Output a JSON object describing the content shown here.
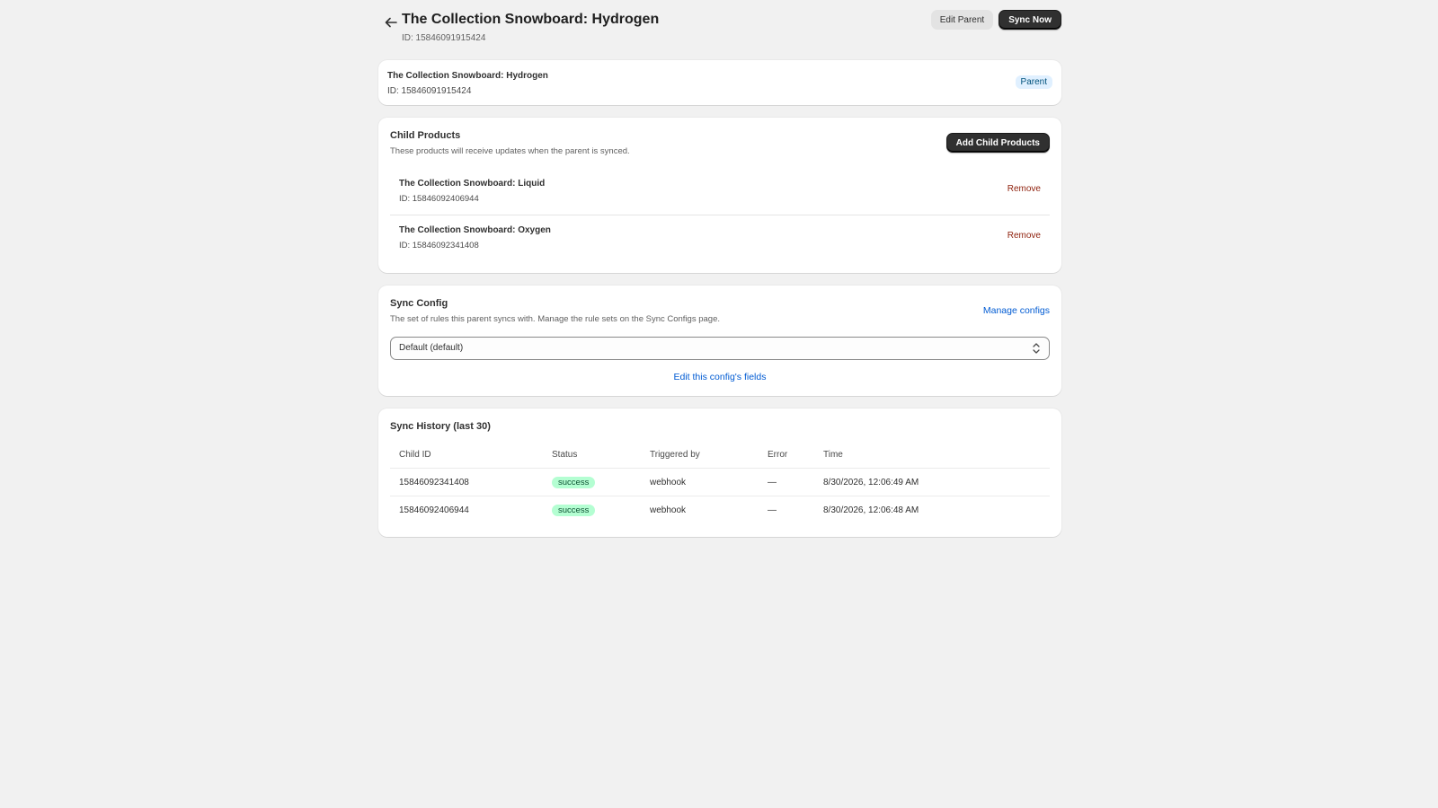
{
  "header": {
    "title": "The Collection Snowboard: Hydrogen",
    "id_text": "ID: 15846091915424",
    "edit_parent_label": "Edit Parent",
    "sync_now_label": "Sync Now"
  },
  "parent_card": {
    "name": "The Collection Snowboard: Hydrogen",
    "id_text": "ID: 15846091915424",
    "badge": "Parent"
  },
  "child_products": {
    "title": "Child Products",
    "description": "These products will receive updates when the parent is synced.",
    "add_label": "Add Child Products",
    "items": [
      {
        "name": "The Collection Snowboard: Liquid",
        "id_text": "ID: 15846092406944",
        "remove_label": "Remove"
      },
      {
        "name": "The Collection Snowboard: Oxygen",
        "id_text": "ID: 15846092341408",
        "remove_label": "Remove"
      }
    ]
  },
  "sync_config": {
    "title": "Sync Config",
    "description": "The set of rules this parent syncs with. Manage the rule sets on the Sync Configs page.",
    "manage_label": "Manage configs",
    "selected": "Default (default)",
    "edit_label": "Edit this config's fields"
  },
  "sync_history": {
    "title": "Sync History (last 30)",
    "columns": [
      "Child ID",
      "Status",
      "Triggered by",
      "Error",
      "Time"
    ],
    "rows": [
      {
        "child_id": "15846092341408",
        "status": "success",
        "triggered_by": "webhook",
        "error": "—",
        "time": "8/30/2026, 12:06:49 AM"
      },
      {
        "child_id": "15846092406944",
        "status": "success",
        "triggered_by": "webhook",
        "error": "—",
        "time": "8/30/2026, 12:06:48 AM"
      }
    ]
  },
  "colors": {
    "background": "#f1f1f1",
    "primary_button": "#303030",
    "link": "#005bd3",
    "critical": "#8e1f0b",
    "success_badge": "#b4fed2",
    "info_badge": "#e0f0ff"
  },
  "icons": {
    "back": "arrow-left-icon",
    "select": "chevron-up-down-icon"
  }
}
